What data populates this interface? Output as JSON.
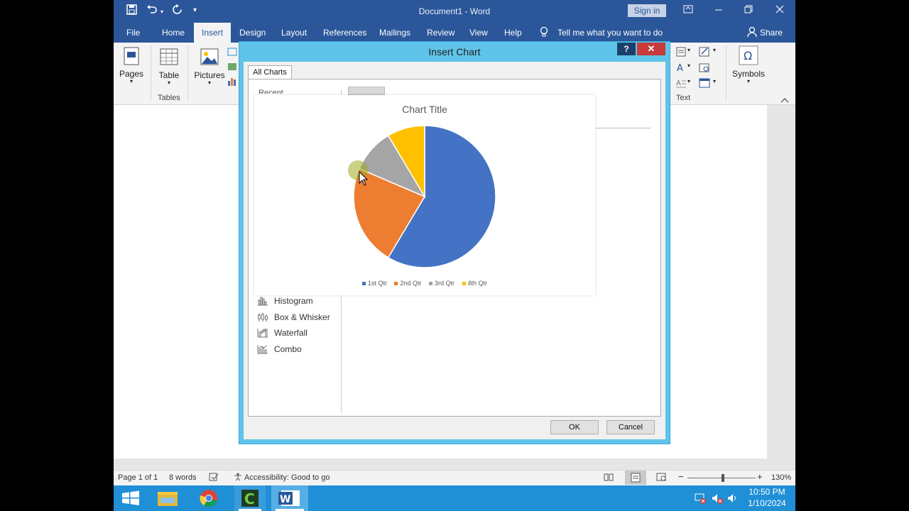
{
  "titlebar": {
    "document_title": "Document1  -  Word",
    "sign_in": "Sign in"
  },
  "ribbon_tabs": [
    "File",
    "Home",
    "Insert",
    "Design",
    "Layout",
    "References",
    "Mailings",
    "Review",
    "View",
    "Help"
  ],
  "active_tab": "Insert",
  "tell_me": "Tell me what you want to do",
  "share": "Share",
  "ribbon": {
    "pages_label": "Pages",
    "table_label": "Table",
    "pictures_label": "Pictures",
    "tables_group": "Tables",
    "text_group": "Text",
    "symbols_label": "Symbols"
  },
  "dialog": {
    "title": "Insert Chart",
    "help": "?",
    "close": "✕",
    "tab": "All Charts",
    "recent": "Recent",
    "categories": [
      "Histogram",
      "Box & Whisker",
      "Waterfall",
      "Combo"
    ],
    "ok": "OK",
    "cancel": "Cancel"
  },
  "chart_data": {
    "type": "pie",
    "title": "Chart Title",
    "categories": [
      "1st Qtr",
      "2nd Qtr",
      "3rd Qtr",
      "4th Qtr"
    ],
    "values": [
      8.2,
      3.2,
      1.4,
      1.2
    ],
    "colors": [
      "#4472c4",
      "#ed7d31",
      "#a5a5a5",
      "#ffc000"
    ],
    "legend_position": "bottom"
  },
  "statusbar": {
    "page": "Page 1 of 1",
    "words": "8 words",
    "accessibility": "Accessibility: Good to go",
    "zoom": "130%"
  },
  "taskbar": {
    "time": "10:50 PM",
    "date": "1/10/2024"
  }
}
